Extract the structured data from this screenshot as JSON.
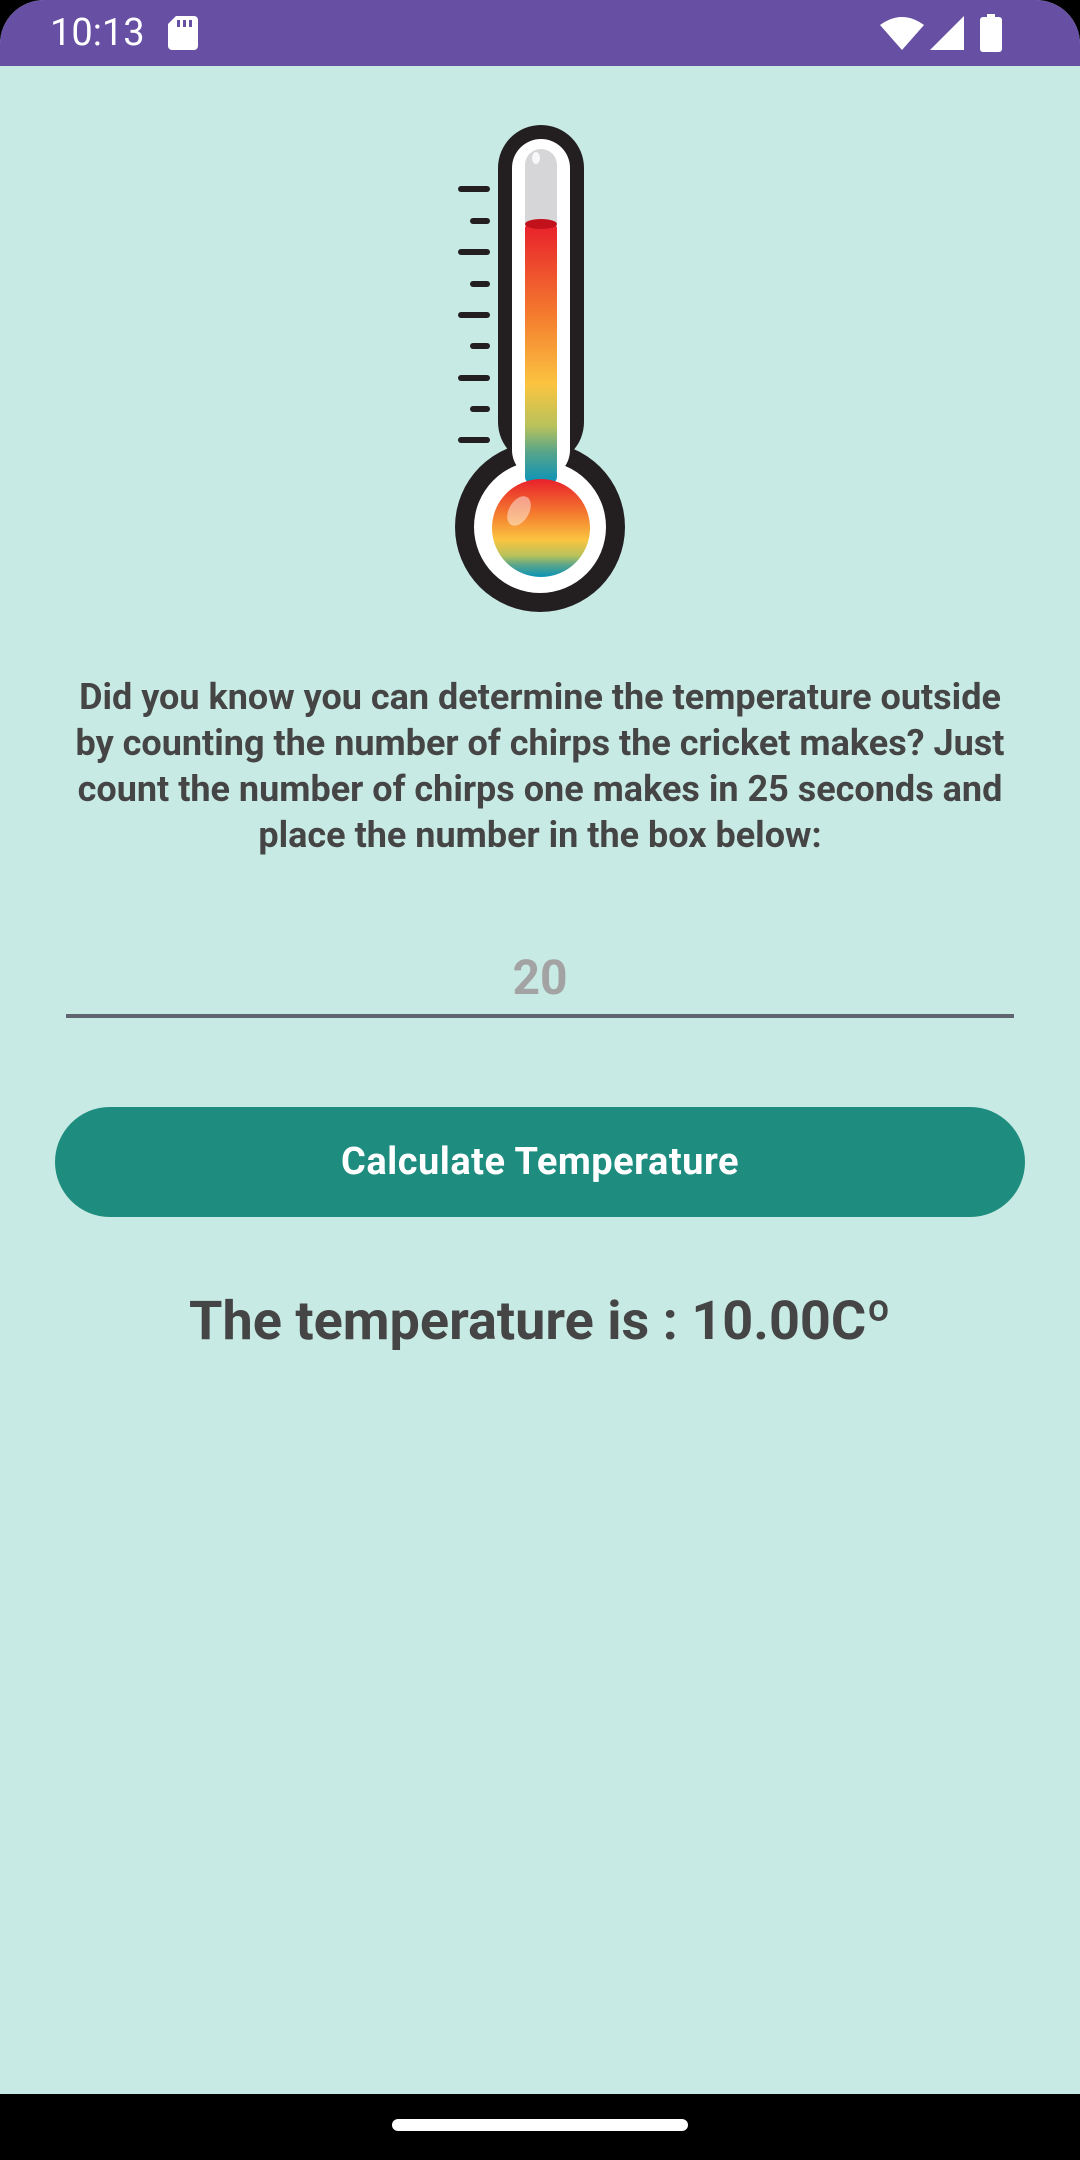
{
  "status_bar": {
    "time": "10:13",
    "icons": [
      "sd-card-icon",
      "wifi-icon",
      "signal-icon",
      "battery-icon"
    ],
    "color": "#6750a4"
  },
  "main": {
    "image": "thermometer-icon",
    "intro_text": "Did you know you can determine the temperature outside by counting the number of chirps the cricket makes? Just count the number of chirps one makes in 25 seconds and place the number in the box below:",
    "chirp_input": {
      "value": "",
      "placeholder": "20"
    },
    "calculate_button": {
      "label": "Calculate Temperature",
      "color": "#1e8c7e"
    },
    "result_text": "The temperature is : 10.00Cº"
  },
  "theme": {
    "background": "#c8eae4",
    "text": "#454545"
  }
}
